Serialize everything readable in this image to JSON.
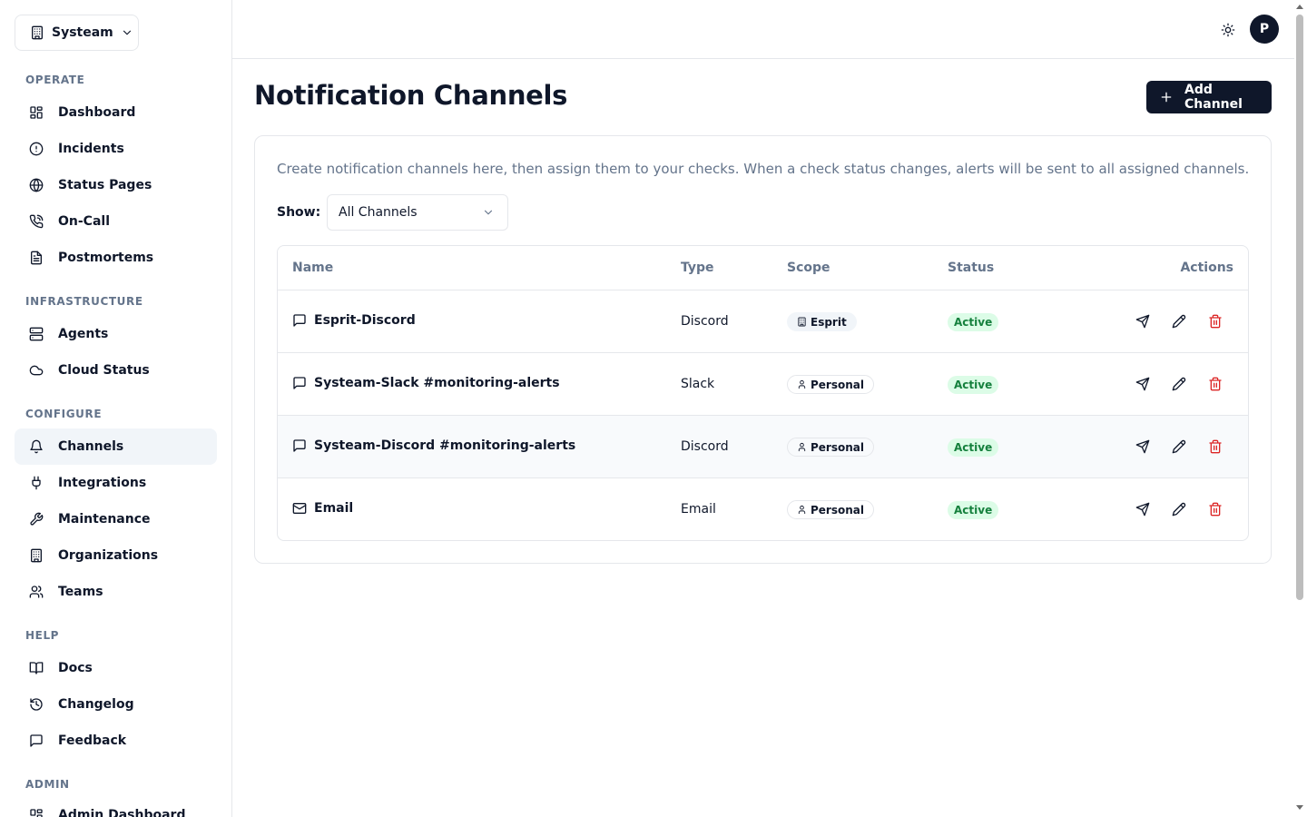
{
  "org": {
    "name": "Systeam"
  },
  "sidebar": {
    "sections": [
      {
        "title": "OPERATE",
        "items": [
          "Dashboard",
          "Incidents",
          "Status Pages",
          "On-Call",
          "Postmortems"
        ]
      },
      {
        "title": "INFRASTRUCTURE",
        "items": [
          "Agents",
          "Cloud Status"
        ]
      },
      {
        "title": "CONFIGURE",
        "items": [
          "Channels",
          "Integrations",
          "Maintenance",
          "Organizations",
          "Teams"
        ]
      },
      {
        "title": "HELP",
        "items": [
          "Docs",
          "Changelog",
          "Feedback"
        ]
      },
      {
        "title": "ADMIN",
        "items": [
          "Admin Dashboard"
        ]
      }
    ],
    "active_item": "Channels"
  },
  "user": {
    "avatar_initial": "P"
  },
  "page": {
    "title": "Notification Channels",
    "add_button_label": "Add Channel",
    "description": "Create notification channels here, then assign them to your checks. When a check status changes, alerts will be sent to all assigned channels.",
    "filter": {
      "label": "Show:",
      "value": "All Channels"
    }
  },
  "table": {
    "headers": {
      "name": "Name",
      "type": "Type",
      "scope": "Scope",
      "status": "Status",
      "actions": "Actions"
    },
    "rows": [
      {
        "name": "Esprit-Discord",
        "icon": "message-square-icon",
        "type": "Discord",
        "scope": "Esprit",
        "scope_kind": "organization",
        "status": "Active"
      },
      {
        "name": "Systeam-Slack #monitoring-alerts",
        "icon": "message-square-icon",
        "type": "Slack",
        "scope": "Personal",
        "scope_kind": "personal",
        "status": "Active"
      },
      {
        "name": "Systeam-Discord #monitoring-alerts",
        "icon": "message-square-icon",
        "type": "Discord",
        "scope": "Personal",
        "scope_kind": "personal",
        "status": "Active"
      },
      {
        "name": "Email",
        "icon": "mail-icon",
        "type": "Email",
        "scope": "Personal",
        "scope_kind": "personal",
        "status": "Active"
      }
    ]
  },
  "colors": {
    "primary": "#0f172a",
    "muted": "#64748b",
    "border": "#e5e7eb",
    "active_bg": "#dcfce7",
    "active_text": "#15803d",
    "danger": "#dc2626"
  }
}
